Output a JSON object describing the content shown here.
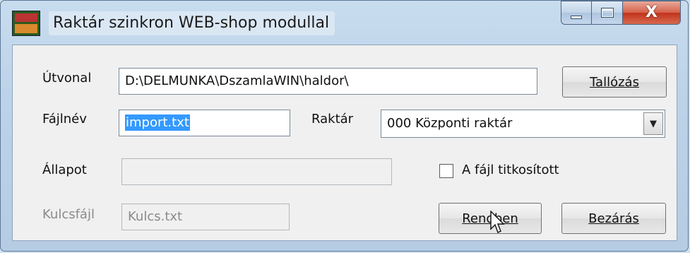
{
  "window": {
    "title": "Raktár szinkron WEB-shop modullal",
    "caption": {
      "min_icon": "minimize-icon",
      "max_icon": "maximize-icon",
      "close_glyph": "X"
    }
  },
  "form": {
    "path_label": "Útvonal",
    "path_value": "D:\\DELMUNKA\\DszamlaWIN\\haldor\\",
    "browse_button": "Tallózás",
    "filename_label": "Fájlnév",
    "filename_value": "import.txt",
    "warehouse_label": "Raktár",
    "warehouse_value": "000 Központi raktár",
    "status_label": "Állapot",
    "status_value": "",
    "encrypted_label": "A fájl titkosított",
    "keyfile_label": "Kulcsfájl",
    "keyfile_value": "Kulcs.txt",
    "ok_button": "Rendben",
    "close_button": "Bezárás"
  },
  "colors": {
    "selection": "#3399ff",
    "close_button": "#c2321b"
  }
}
